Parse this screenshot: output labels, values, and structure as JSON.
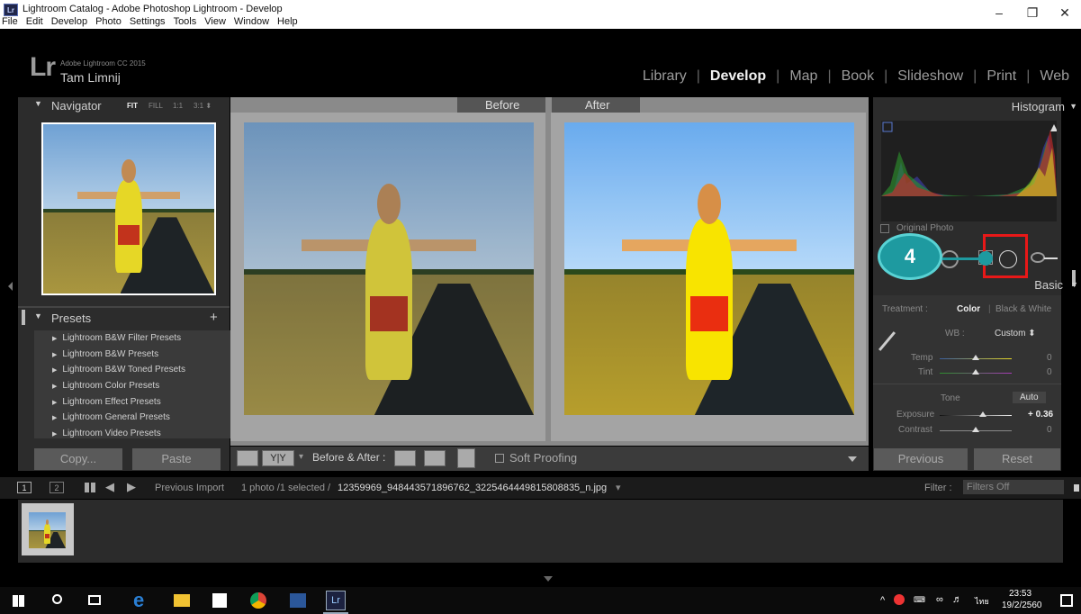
{
  "window": {
    "title": "Lightroom Catalog - Adobe Photoshop Lightroom - Develop",
    "app_icon_text": "Lr",
    "controls": {
      "minimize": "–",
      "maximize": "❐",
      "close": "✕"
    }
  },
  "menu": [
    "File",
    "Edit",
    "Develop",
    "Photo",
    "Settings",
    "Tools",
    "View",
    "Window",
    "Help"
  ],
  "identity": {
    "logo": "Lr",
    "product": "Adobe Lightroom CC 2015",
    "user": "Tam Limnij"
  },
  "modules": [
    {
      "label": "Library",
      "active": false
    },
    {
      "label": "Develop",
      "active": true
    },
    {
      "label": "Map",
      "active": false
    },
    {
      "label": "Book",
      "active": false
    },
    {
      "label": "Slideshow",
      "active": false
    },
    {
      "label": "Print",
      "active": false
    },
    {
      "label": "Web",
      "active": false
    }
  ],
  "module_separator": "|",
  "left_panel": {
    "navigator": {
      "title": "Navigator",
      "triangle": "▼",
      "zoom_fit": "FIT",
      "zoom_fill": "FILL",
      "zoom_1_1": "1:1",
      "zoom_3_1": "3:1 ⬍"
    },
    "presets": {
      "title": "Presets",
      "triangle": "▼",
      "add": "+",
      "items": [
        "Lightroom B&W Filter Presets",
        "Lightroom B&W Presets",
        "Lightroom B&W Toned Presets",
        "Lightroom Color Presets",
        "Lightroom Effect Presets",
        "Lightroom General Presets",
        "Lightroom Video Presets"
      ]
    },
    "copy_label": "Copy...",
    "paste_label": "Paste"
  },
  "main": {
    "before_label": "Before",
    "after_label": "After"
  },
  "toolbar": {
    "yy_label": "Y|Y",
    "dropdown": "▾",
    "before_after_label": "Before & After :",
    "soft_proofing_label": "Soft Proofing"
  },
  "right_panel": {
    "histogram_title": "Histogram",
    "triangle": "▼",
    "original_photo_label": "Original Photo",
    "basic_title": "Basic",
    "treatment_label": "Treatment :",
    "treatment_color": "Color",
    "treatment_bw": "Black & White",
    "wb_label": "WB :",
    "wb_value": "Custom ⬍",
    "temp_label": "Temp",
    "temp_value": "0",
    "tint_label": "Tint",
    "tint_value": "0",
    "tone_label": "Tone",
    "auto_label": "Auto",
    "exposure_label": "Exposure",
    "exposure_value": "+ 0.36",
    "contrast_label": "Contrast",
    "contrast_value": "0",
    "previous_label": "Previous",
    "reset_label": "Reset"
  },
  "filmbar": {
    "view1": "1",
    "view2": "2",
    "source": "Previous Import",
    "info_prefix": "1 photo /1 selected /",
    "filename": "12359969_948443571896762_3225464449815808835_n.jpg",
    "dropdown": "▾",
    "filter_label": "Filter :",
    "filter_value": "Filters Off"
  },
  "annotation": {
    "step_number": "4"
  },
  "taskbar": {
    "time": "23:53",
    "date": "19/2/2560",
    "lang": "ไทย"
  },
  "colors": {
    "accent_teal": "#1e9aa0",
    "highlight_red": "#e81818",
    "panel_bg": "#2c2c2c",
    "active_module": "#f2f2f2"
  }
}
